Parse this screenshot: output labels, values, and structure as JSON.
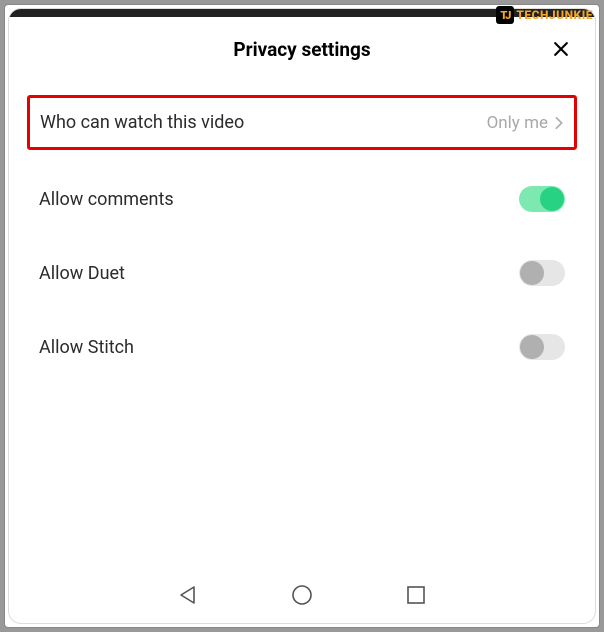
{
  "watermark": {
    "logo": "TJ",
    "text": "TECHJUNKIE"
  },
  "header": {
    "title": "Privacy settings"
  },
  "settings": {
    "who_can_watch": {
      "label": "Who can watch this video",
      "value": "Only me"
    },
    "allow_comments": {
      "label": "Allow comments",
      "enabled": true
    },
    "allow_duet": {
      "label": "Allow Duet",
      "enabled": false
    },
    "allow_stitch": {
      "label": "Allow Stitch",
      "enabled": false
    }
  }
}
